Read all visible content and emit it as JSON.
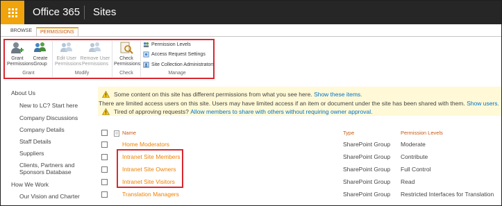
{
  "suitebar": {
    "brand": "Office 365",
    "app": "Sites",
    "waffle_icon": "waffle-icon"
  },
  "tabs": {
    "browse": "BROWSE",
    "permissions": "PERMISSIONS"
  },
  "ribbon": {
    "grant": {
      "label1": "Grant",
      "label2": "Permissions",
      "icon": "grant-permissions-icon"
    },
    "create_group": {
      "label1": "Create",
      "label2": "Group",
      "icon": "create-group-icon"
    },
    "edit_user": {
      "label1": "Edit User",
      "label2": "Permissions",
      "icon": "edit-user-icon"
    },
    "remove_user": {
      "label1": "Remove User",
      "label2": "Permissions",
      "icon": "remove-user-icon"
    },
    "check": {
      "label1": "Check",
      "label2": "Permissions",
      "icon": "check-permissions-icon"
    },
    "permission_levels": "Permission Levels",
    "access_request": "Access Request Settings",
    "site_collection_admins": "Site Collection Administrators",
    "groups": {
      "grant": "Grant",
      "modify": "Modify",
      "check": "Check",
      "manage": "Manage"
    },
    "accent": "#d9272e"
  },
  "leftnav": {
    "items": [
      "About Us",
      "New to LC? Start here",
      "Company Discussions",
      "Company Details",
      "Staff Details",
      "Suppliers",
      "Clients, Partners and",
      "Sponsors Database",
      "How We Work",
      "Our Vision and Charter"
    ]
  },
  "status": {
    "line1_text": "Some content on this site has different permissions from what you see here.",
    "line1_link": "Show these items.",
    "line2_text": "There are limited access users on this site. Users may have limited access if an item or document under the site has been shared with them.",
    "line2_link": "Show users.",
    "line3_text": "Tired of approving requests?",
    "line3_link": "Allow members to share with others without requiring owner approval."
  },
  "table": {
    "headers": {
      "name": "Name",
      "type": "Type",
      "perm": "Permission Levels"
    },
    "rows": [
      {
        "name": "Home Moderators",
        "type": "SharePoint Group",
        "perm": "Moderate"
      },
      {
        "name": "Intranet Site Members",
        "type": "SharePoint Group",
        "perm": "Contribute"
      },
      {
        "name": "Intranet Site Owners",
        "type": "SharePoint Group",
        "perm": "Full Control"
      },
      {
        "name": "Intranet Site Visitors",
        "type": "SharePoint Group",
        "perm": "Read"
      },
      {
        "name": "Translation Managers",
        "type": "SharePoint Group",
        "perm": "Restricted Interfaces for Translation"
      }
    ]
  },
  "colors": {
    "suitebar": "#262626",
    "waffle": "#f0a30a",
    "link": "#0072c6",
    "orange": "#f08000",
    "status_bg": "#fff9d7"
  }
}
